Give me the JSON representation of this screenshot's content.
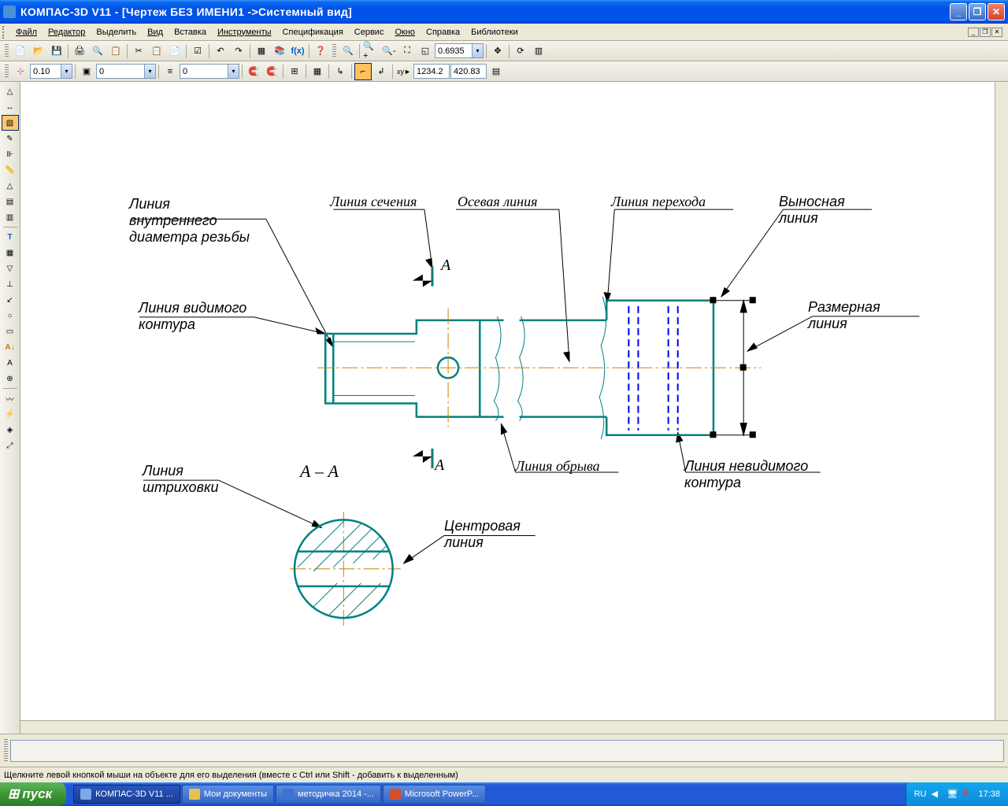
{
  "titlebar": {
    "text": "КОМПАС-3D V11 -  [Чертеж БЕЗ ИМЕНИ1 ->Системный вид]"
  },
  "menu": {
    "items": [
      "Файл",
      "Редактор",
      "Выделить",
      "Вид",
      "Вставка",
      "Инструменты",
      "Спецификация",
      "Сервис",
      "Окно",
      "Справка",
      "Библиотеки"
    ]
  },
  "toolbar2": {
    "zoom": "0.6935"
  },
  "toolbar3": {
    "step": "0.10",
    "layer": "0",
    "style": "0",
    "coordX": "1234.2",
    "coordY": "420.83"
  },
  "drawing": {
    "labels": {
      "inner_thread": "Линия\nвнутреннего\nдиаметра резьбы",
      "visible_contour": "Линия видимого\nконтура",
      "hatch": "Линия\nштриховки",
      "section": "Линия сечения",
      "axial": "Осевая линия",
      "transition": "Линия перехода",
      "extension": "Выносная\nлиния",
      "dimension": "Размерная\nлиния",
      "break": "Линия обрыва",
      "invisible": "Линия невидимого\nконтура",
      "center": "Центровая\nлиния",
      "section_mark_top": "А",
      "section_mark_bot": "А",
      "section_view": "А – А"
    }
  },
  "statusbar": {
    "text": "Щелкните левой кнопкой мыши на объекте для его выделения (вместе с Ctrl или Shift - добавить к выделенным)"
  },
  "taskbar": {
    "start": "пуск",
    "tasks": [
      "КОМПАС-3D V11 ...",
      "Мои документы",
      "методичка 2014 -...",
      "Microsoft PowerP..."
    ],
    "lang": "RU",
    "time": "17:38"
  }
}
